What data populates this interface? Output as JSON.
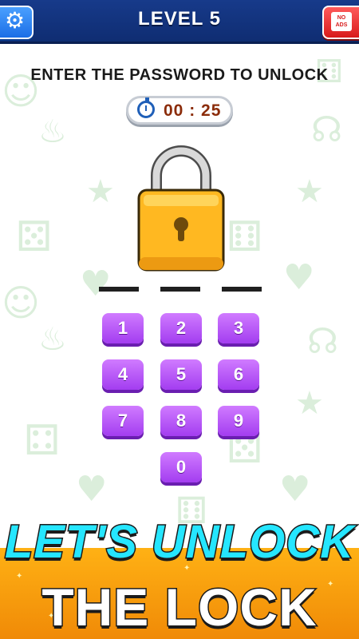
{
  "header": {
    "title": "LEVEL 5",
    "settings_icon": "gear-icon",
    "noads_label": "NO ADS"
  },
  "instruction": "ENTER THE PASSWORD TO UNLOCK",
  "timer": {
    "icon": "stopwatch-icon",
    "value": "00 : 25"
  },
  "lock": {
    "icon": "padlock-icon",
    "code_length": 3
  },
  "keypad": {
    "keys": [
      "1",
      "2",
      "3",
      "4",
      "5",
      "6",
      "7",
      "8",
      "9",
      "0"
    ]
  },
  "banner": {
    "line1": "LET'S UNLOCK",
    "line2": "THE LOCK"
  },
  "colors": {
    "header": "#173a8a",
    "key": "#b04ff5",
    "lock": "#ffb821",
    "banner": "#ffa210",
    "timer_text": "#8b2c0a"
  }
}
